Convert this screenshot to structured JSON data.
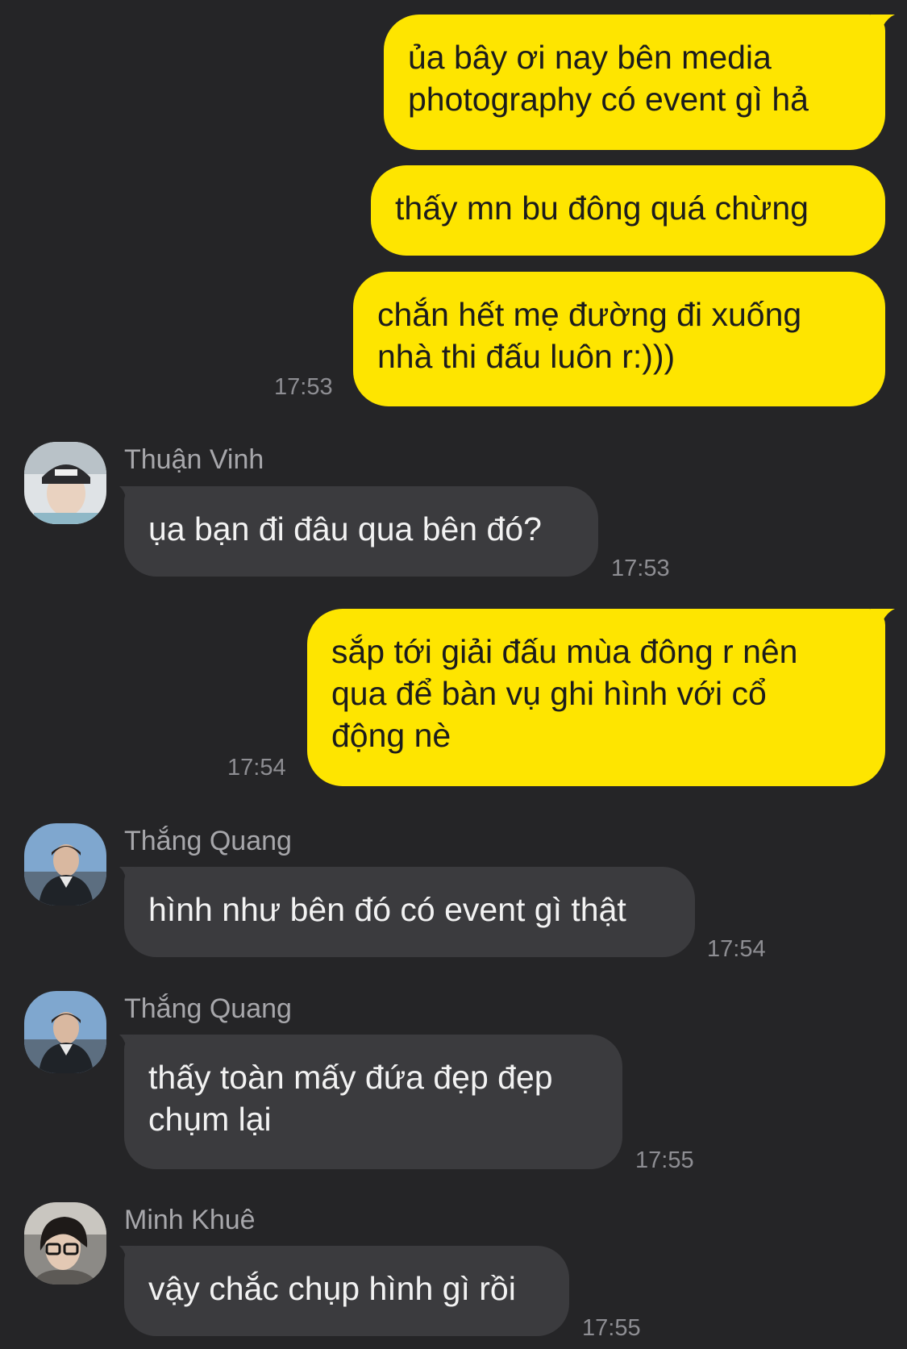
{
  "chat": {
    "messages": [
      {
        "text": "ủa bây ơi nay bên media\nphotography có event gì hả"
      },
      {
        "text": "thấy mn bu đông quá chừng"
      },
      {
        "text": "chắn hết mẹ đường đi xuống\nnhà thi đấu luôn r:)))",
        "time": "17:53"
      },
      {
        "sender": "Thuận Vinh",
        "avatar": "avatar-thuan-vinh",
        "text": "ụa bạn đi đâu qua bên đó?",
        "time": "17:53"
      },
      {
        "text": "sắp tới giải đấu mùa đông r nên\nqua để bàn vụ ghi hình với cổ\nđộng nè",
        "time": "17:54"
      },
      {
        "sender": "Thắng Quang",
        "avatar": "avatar-thang-quang",
        "text": "hình như bên đó có event gì thật",
        "time": "17:54"
      },
      {
        "sender": "Thắng Quang",
        "avatar": "avatar-thang-quang",
        "text": "thấy toàn mấy đứa đẹp đẹp\nchụm lại",
        "time": "17:55"
      },
      {
        "sender": "Minh Khuê",
        "avatar": "avatar-minh-khue",
        "text": "vậy chắc chụp hình gì rồi",
        "time": "17:55"
      }
    ]
  },
  "colors": {
    "background": "#252527",
    "my_bubble": "#FEE500",
    "their_bubble": "#3b3b3e",
    "timestamp": "#8e8e93"
  }
}
